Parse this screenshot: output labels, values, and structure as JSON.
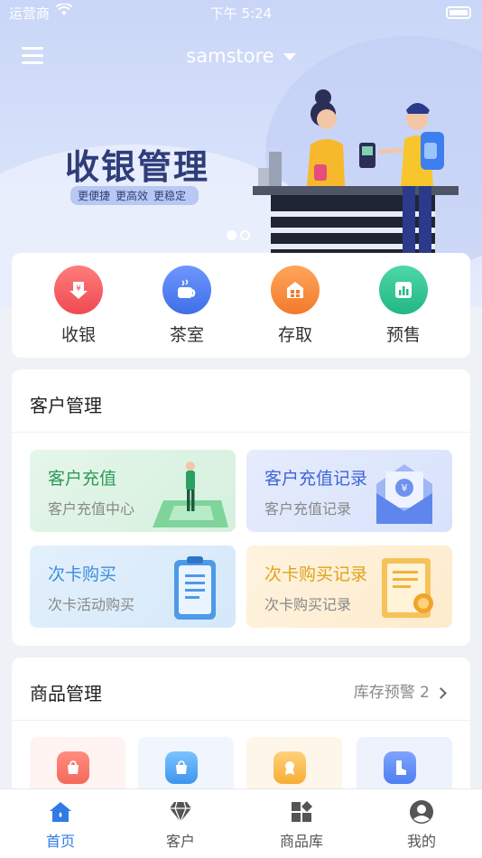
{
  "status": {
    "carrier": "运营商",
    "time": "下午 5:24"
  },
  "header": {
    "store_name": "samstore"
  },
  "banner": {
    "title": "收银管理",
    "tags": [
      "更便捷",
      "更高效",
      "更稳定"
    ]
  },
  "quick_actions": [
    {
      "label": "收银",
      "icon": "cashier-icon",
      "color": "#f0555a"
    },
    {
      "label": "茶室",
      "icon": "tea-cup-icon",
      "color": "#4f7ef0"
    },
    {
      "label": "存取",
      "icon": "storage-icon",
      "color": "#f7853a"
    },
    {
      "label": "预售",
      "icon": "presale-chart-icon",
      "color": "#2cc08f"
    }
  ],
  "customer": {
    "title": "客户管理",
    "tiles": [
      {
        "title": "客户充值",
        "sub": "客户充值中心",
        "title_color": "#2e9a55"
      },
      {
        "title": "客户充值记录",
        "sub": "客户充值记录",
        "title_color": "#3f64d6"
      },
      {
        "title": "次卡购买",
        "sub": "次卡活动购买",
        "title_color": "#3b8ee0"
      },
      {
        "title": "次卡购买记录",
        "sub": "次卡购买记录",
        "title_color": "#e0a21a"
      }
    ]
  },
  "goods": {
    "title": "商品管理",
    "warning": "库存预警 2"
  },
  "tabs": [
    {
      "label": "首页",
      "icon": "home-icon"
    },
    {
      "label": "客户",
      "icon": "diamond-icon"
    },
    {
      "label": "商品库",
      "icon": "grid-icon"
    },
    {
      "label": "我的",
      "icon": "profile-icon"
    }
  ]
}
